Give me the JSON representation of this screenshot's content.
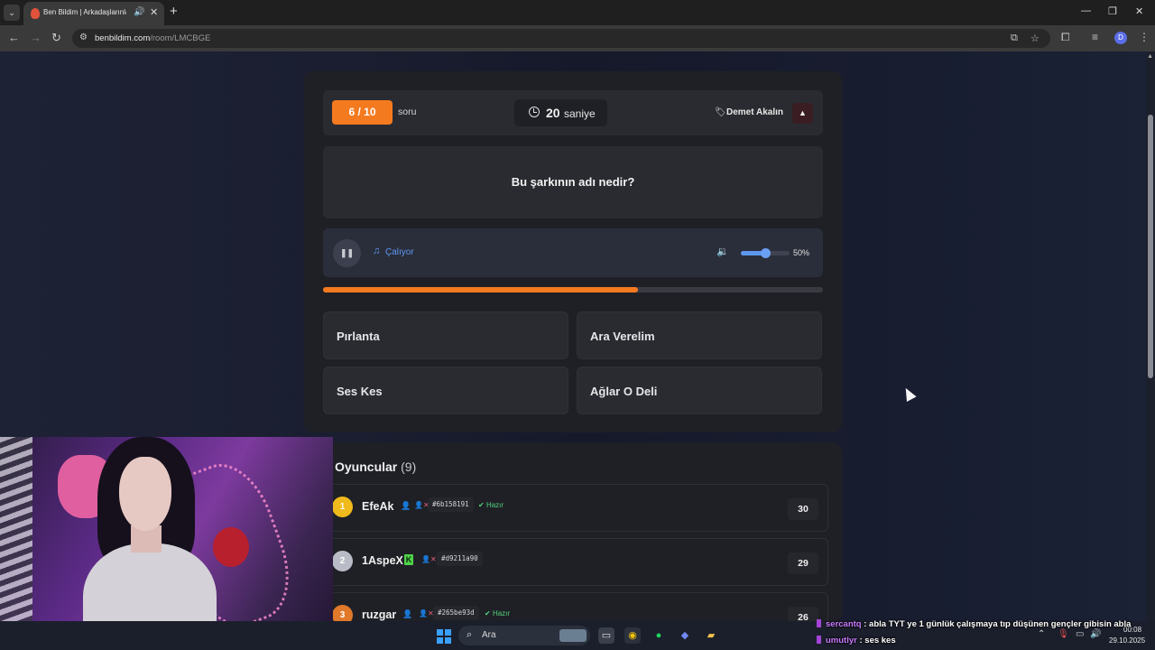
{
  "browser": {
    "tab_title": "Ben Bildim | Arkadaşlarınla",
    "url_domain": "benbildim.com",
    "url_path": "/room/LMCBGE",
    "profile_initial": "D"
  },
  "header": {
    "question_counter": "6 / 10",
    "question_label": "soru",
    "timer_value": "20",
    "timer_unit": "saniye",
    "owner_name": "Demet Akalın"
  },
  "question": {
    "text": "Bu şarkının adı nedir?"
  },
  "player": {
    "status": "Çalıyor",
    "volume_text": "50%",
    "volume_fraction": 0.5,
    "song_progress_fraction": 0.63
  },
  "answers": [
    {
      "label": "Pırlanta"
    },
    {
      "label": "Ara Verelim"
    },
    {
      "label": "Ses Kes"
    },
    {
      "label": "Ağlar O Deli"
    }
  ],
  "players": {
    "title": "Oyuncular",
    "count": "(9)",
    "list": [
      {
        "rank": "1",
        "name": "EfeAk",
        "id": "#6b158191",
        "status": "Hazır",
        "score": "30",
        "rank_color": "#f0b91c"
      },
      {
        "rank": "2",
        "name": "1AspeX",
        "id": "#d9211a90",
        "status": "",
        "score": "29",
        "rank_color": "#b9bcc6"
      },
      {
        "rank": "3",
        "name": "ruzgar",
        "id": "#265be93d",
        "status": "Hazır",
        "score": "26",
        "rank_color": "#e0792a"
      }
    ]
  },
  "taskbar": {
    "search_label": "Ara",
    "time": "00:08",
    "date": "29.10.2025"
  },
  "chat": [
    {
      "user": "sercantq",
      "message": ": abla TYT ye 1 günlük çalışmaya tıp düşünen gençler gibisin abla"
    },
    {
      "user": "umutlyr",
      "message": ": ses kes"
    }
  ],
  "colors": {
    "accent_orange": "#f47a20",
    "accent_blue": "#5e97f2",
    "ready_green": "#52d17c"
  }
}
